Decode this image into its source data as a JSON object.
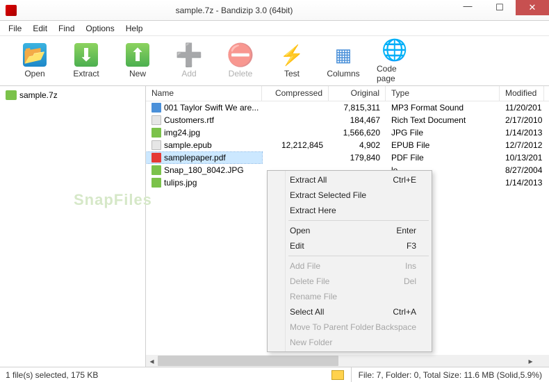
{
  "window": {
    "title": "sample.7z - Bandizip 3.0 (64bit)"
  },
  "menu": {
    "file": "File",
    "edit": "Edit",
    "find": "Find",
    "options": "Options",
    "help": "Help"
  },
  "toolbar": {
    "open": "Open",
    "extract": "Extract",
    "new": "New",
    "add": "Add",
    "delete": "Delete",
    "test": "Test",
    "columns": "Columns",
    "codepage": "Code page"
  },
  "tree": {
    "root": "sample.7z"
  },
  "columns": {
    "name": "Name",
    "compressed": "Compressed",
    "original": "Original",
    "type": "Type",
    "modified": "Modified"
  },
  "rows": [
    {
      "icon": "fi-mp3",
      "name": "001 Taylor Swift We are...",
      "comp": "",
      "orig": "7,815,311",
      "type": "MP3 Format Sound",
      "mod": "11/20/201"
    },
    {
      "icon": "fi-rtf",
      "name": "Customers.rtf",
      "comp": "",
      "orig": "184,467",
      "type": "Rich Text Document",
      "mod": "2/17/2010"
    },
    {
      "icon": "fi-jpg",
      "name": "img24.jpg",
      "comp": "",
      "orig": "1,566,620",
      "type": "JPG File",
      "mod": "1/14/2013"
    },
    {
      "icon": "fi-epub",
      "name": "sample.epub",
      "comp": "12,212,845",
      "orig": "4,902",
      "type": "EPUB File",
      "mod": "12/7/2012"
    },
    {
      "icon": "fi-pdf",
      "name": "samplepaper.pdf",
      "comp": "",
      "orig": "179,840",
      "type": "PDF File",
      "mod": "10/13/201",
      "sel": true
    },
    {
      "icon": "fi-jpg",
      "name": "Snap_180_8042.JPG",
      "comp": "",
      "orig": "",
      "type": "le",
      "mod": "8/27/2004"
    },
    {
      "icon": "fi-jpg",
      "name": "tulips.jpg",
      "comp": "",
      "orig": "",
      "type": "le",
      "mod": "1/14/2013"
    }
  ],
  "context": {
    "items": [
      {
        "label": "Extract All",
        "accel": "Ctrl+E"
      },
      {
        "label": "Extract Selected File"
      },
      {
        "label": "Extract Here"
      },
      {
        "sep": true
      },
      {
        "label": "Open",
        "accel": "Enter"
      },
      {
        "label": "Edit",
        "accel": "F3"
      },
      {
        "sep": true
      },
      {
        "label": "Add File",
        "accel": "Ins",
        "dis": true
      },
      {
        "label": "Delete File",
        "accel": "Del",
        "dis": true
      },
      {
        "label": "Rename File",
        "dis": true
      },
      {
        "label": "Select All",
        "accel": "Ctrl+A"
      },
      {
        "label": "Move To Parent Folder",
        "accel": "Backspace",
        "dis": true
      },
      {
        "label": "New Folder",
        "dis": true
      }
    ]
  },
  "status": {
    "left": "1 file(s) selected, 175 KB",
    "right": "File: 7, Folder: 0, Total Size: 11.6 MB (Solid,5.9%)"
  }
}
